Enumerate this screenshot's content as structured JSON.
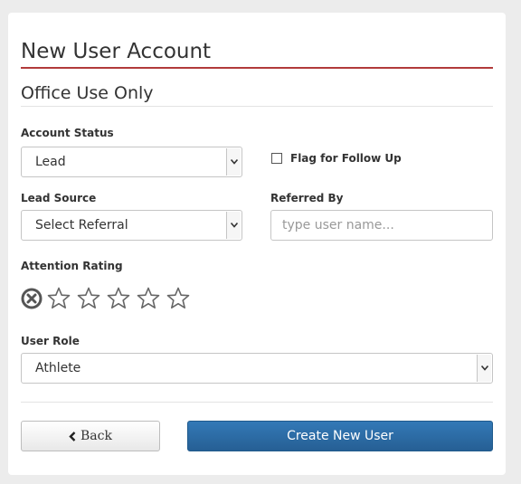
{
  "form": {
    "title": "New User Account",
    "section_title": "Office Use Only",
    "account_status": {
      "label": "Account Status",
      "value": "Lead"
    },
    "flag_follow_up": {
      "label": "Flag for Follow Up",
      "checked": false
    },
    "lead_source": {
      "label": "Lead Source",
      "value": "Select Referral"
    },
    "referred_by": {
      "label": "Referred By",
      "placeholder": "type user name..."
    },
    "attention_rating": {
      "label": "Attention Rating",
      "value": 0,
      "max": 5
    },
    "user_role": {
      "label": "User Role",
      "value": "Athlete"
    }
  },
  "buttons": {
    "back_label": "Back",
    "create_label": "Create New User"
  },
  "colors": {
    "title_rule": "#b23b3b",
    "primary_button": "#2d6da8"
  }
}
